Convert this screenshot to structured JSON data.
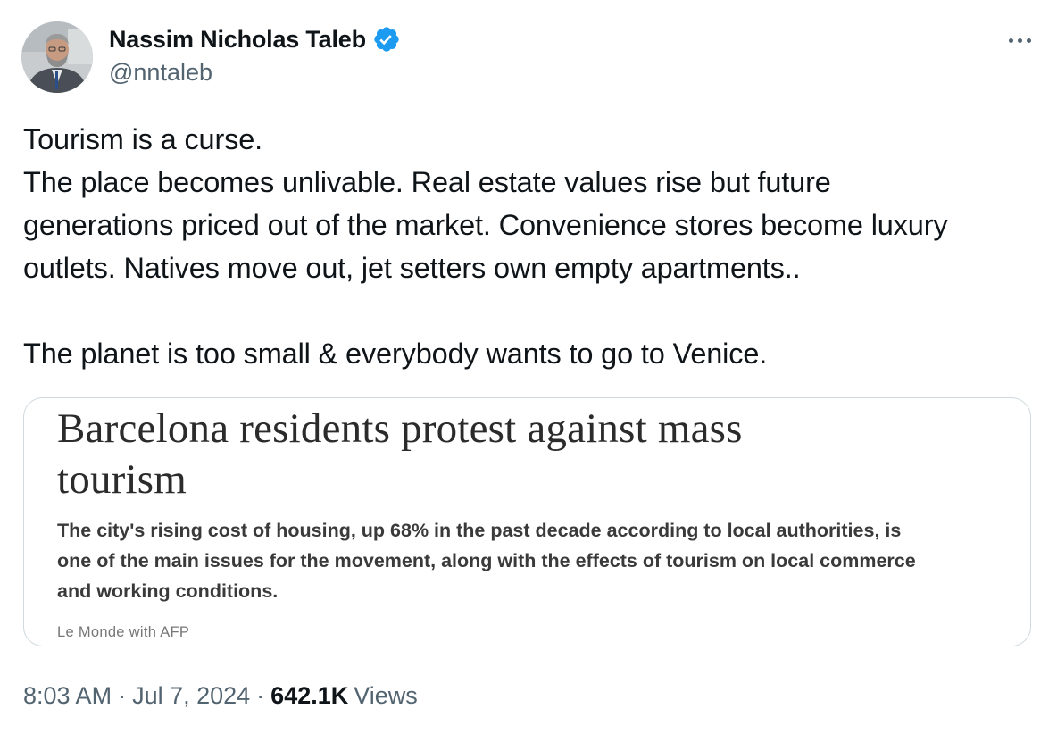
{
  "author": {
    "display_name": "Nassim Nicholas Taleb",
    "handle": "@nntaleb",
    "verified_icon": "verified-badge-icon",
    "verified_color": "#1d9bf0"
  },
  "tweet": {
    "lines": [
      "Tourism is a curse.",
      "The place becomes unlivable. Real estate values rise but future",
      "generations priced out of the market. Convenience stores become luxury",
      "outlets. Natives move out, jet setters own empty apartments.."
    ],
    "closing_line": "The planet is too small & everybody wants to go to Venice."
  },
  "card": {
    "headline_lines": [
      "Barcelona residents protest against mass",
      "tourism"
    ],
    "summary_lines": [
      "The city's rising cost of housing, up 68% in the past decade according to local authorities, is",
      "one of the main issues for the movement, along with the effects of tourism on local commerce",
      "and working conditions."
    ],
    "source": "Le Monde with AFP"
  },
  "meta": {
    "time": "8:03 AM",
    "separator": "·",
    "date": "Jul 7, 2024",
    "views_count": "642.1K",
    "views_label": "Views"
  },
  "icons": {
    "more": "more-options-icon"
  }
}
